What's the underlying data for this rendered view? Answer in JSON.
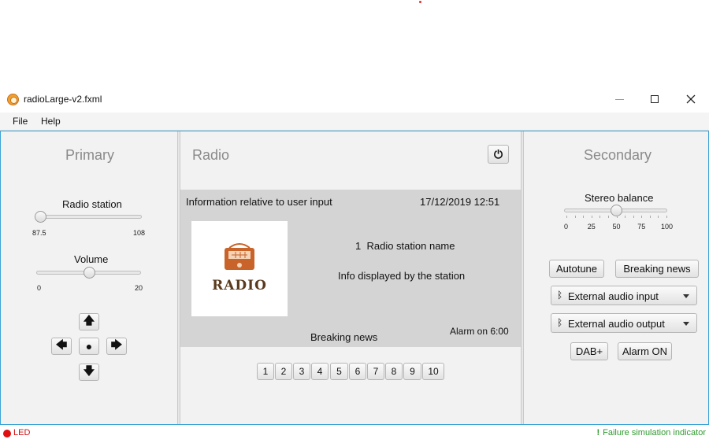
{
  "window": {
    "title": "radioLarge-v2.fxml"
  },
  "menu": {
    "file": "File",
    "help": "Help"
  },
  "primary": {
    "title": "Primary",
    "station_label": "Radio station",
    "station_min": "87.5",
    "station_max": "108",
    "station_value": 87.5,
    "volume_label": "Volume",
    "volume_min": "0",
    "volume_max": "20",
    "volume_value": 10,
    "nav": {
      "up": "🡅",
      "left": "🡄",
      "center": "●",
      "right": "🡆",
      "down": "🡇"
    }
  },
  "radio": {
    "title": "Radio",
    "power_icon": "⏻",
    "info_text": "Information relative to user input",
    "datetime": "17/12/2019 12:51",
    "logo_text": "RADIO",
    "station_number": "1",
    "station_name": "Radio station name",
    "station_info": "Info displayed by the station",
    "alarm": "Alarm on 6:00",
    "breaking": "Breaking news",
    "presets": [
      "1",
      "2",
      "3",
      "4",
      "5",
      "6",
      "7",
      "8",
      "9",
      "10"
    ]
  },
  "secondary": {
    "title": "Secondary",
    "balance_label": "Stereo balance",
    "balance_ticks": [
      "0",
      "25",
      "50",
      "75",
      "100"
    ],
    "balance_value": 50,
    "autotune": "Autotune",
    "breaking_news": "Breaking news",
    "bluetooth_icon": "ᛒ",
    "ext_input": "External audio input",
    "ext_output": "External audio output",
    "dab": "DAB+",
    "alarm_on": "Alarm ON"
  },
  "status": {
    "led": "LED",
    "failure_mark": "!",
    "failure": "Failure simulation indicator"
  },
  "colors": {
    "accent": "#3aa3d6",
    "led": "#e01010",
    "ok": "#2e9a2e",
    "logo": "#c8632a"
  }
}
